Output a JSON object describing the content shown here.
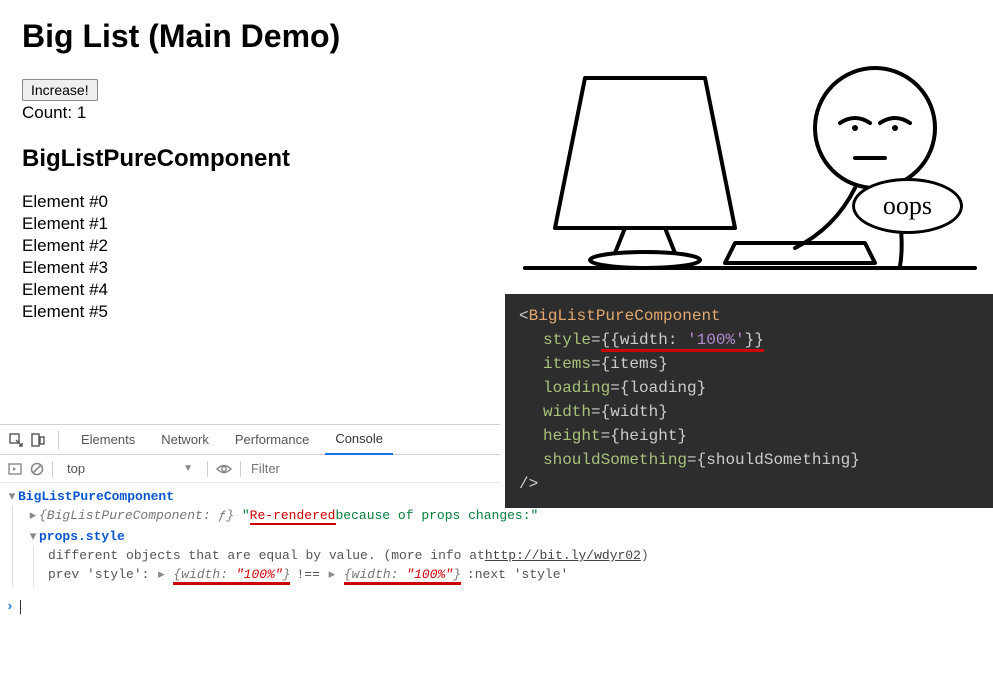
{
  "page": {
    "title": "Big List (Main Demo)",
    "increase_label": "Increase!",
    "count_label": "Count:",
    "count_value": "1",
    "subheading": "BigListPureComponent",
    "elements": [
      "Element #0",
      "Element #1",
      "Element #2",
      "Element #3",
      "Element #4",
      "Element #5"
    ]
  },
  "illustration": {
    "speech": "oops"
  },
  "code": {
    "component": "BigListPureComponent",
    "style_attr": "style",
    "style_obj_open": "{{",
    "style_key": "width:",
    "style_val": "'100%'",
    "style_obj_close": "}}",
    "props": [
      {
        "name": "items",
        "value": "items"
      },
      {
        "name": "loading",
        "value": "loading"
      },
      {
        "name": "width",
        "value": "width"
      },
      {
        "name": "height",
        "value": "height"
      },
      {
        "name": "shouldSomething",
        "value": "shouldSomething"
      }
    ],
    "close": "/>"
  },
  "devtools": {
    "tabs": [
      "Elements",
      "Network",
      "Performance",
      "Console"
    ],
    "active_tab": "Console",
    "context": "top",
    "filter_placeholder": "Filter",
    "console": {
      "component_name": "BigListPureComponent",
      "obj_preview": "{BigListPureComponent: ƒ}",
      "rerendered": "Re-rendered",
      "reason_rest": " because of props changes:\"",
      "prop_path": "props.style",
      "diff_msg_prefix": "different objects that are equal by value. (more info at ",
      "diff_link": "http://bit.ly/wdyr02",
      "diff_msg_suffix": ")",
      "prev_label": "prev 'style':",
      "obj_open": "{width:",
      "obj_val": "\"100%\"",
      "obj_close": "}",
      "neq": "!==",
      "next_label": ":next 'style'"
    }
  }
}
